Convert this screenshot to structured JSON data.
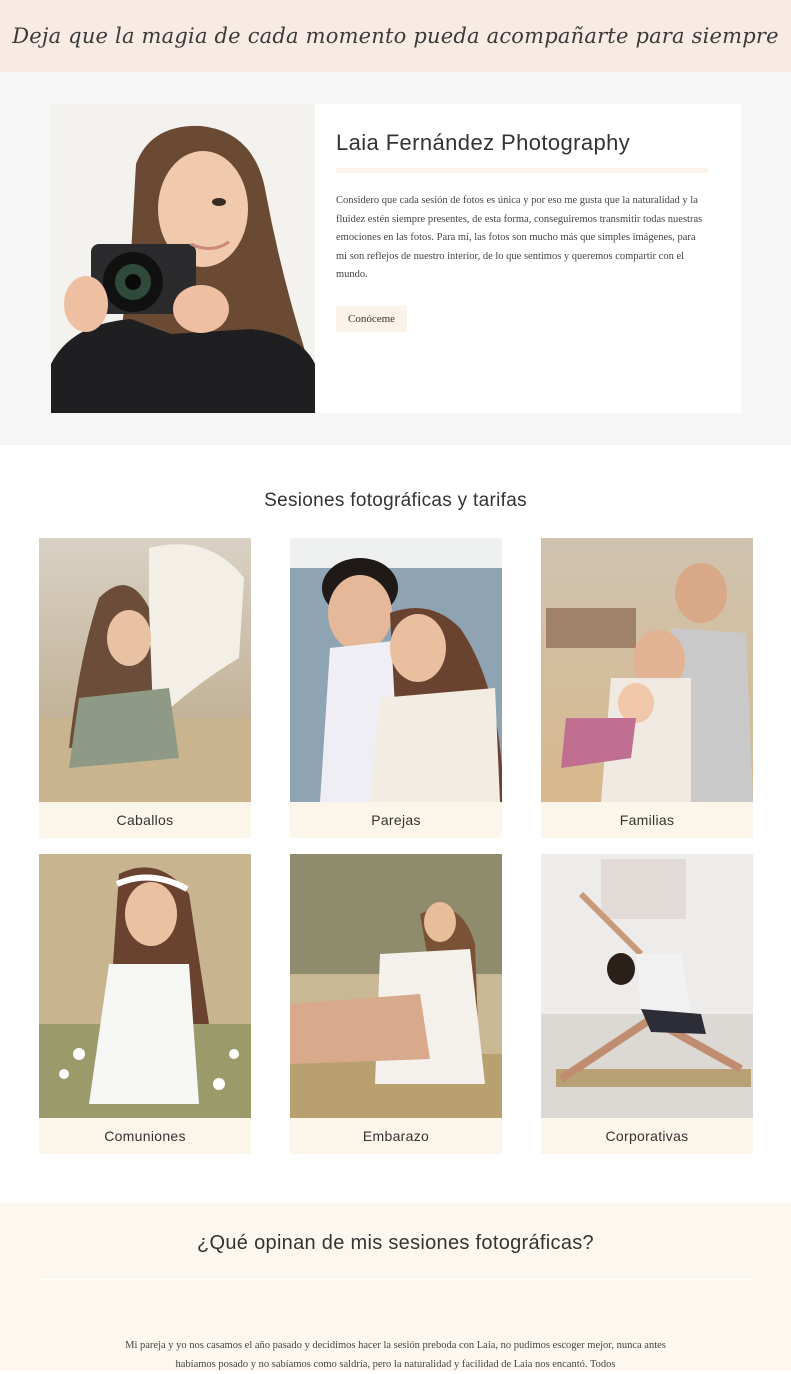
{
  "banner": {
    "tagline": "Deja que la magia de cada momento pueda acompañarte para siempre"
  },
  "about": {
    "title": "Laia Fernández Photography",
    "text": "Considero que cada sesión de fotos es única y por eso me gusta que la naturalidad y la fluidez estén siempre presentes, de esta forma, conseguiremos transmitir todas nuestras emociones en las fotos. Para mí, las fotos son mucho más que simples imágenes, para mi son reflejos de nuestro interior, de lo que sentimos y queremos compartir con el mundo.",
    "button_label": "Conóceme"
  },
  "sessions": {
    "title": "Sesiones fotográficas y tarifas",
    "items": [
      {
        "label": "Caballos"
      },
      {
        "label": "Parejas"
      },
      {
        "label": "Familias"
      },
      {
        "label": "Comuniones"
      },
      {
        "label": "Embarazo"
      },
      {
        "label": "Corporativas"
      }
    ]
  },
  "testimonials": {
    "title": "¿Qué opinan de mis sesiones fotográficas?",
    "text": "Mi pareja y yo nos casamos el año pasado y decidimos hacer la sesión preboda con Laia, no pudimos escoger mejor, nunca antes habíamos posado y no sabíamos como saldría, pero la naturalidad y facilidad de Laia nos encantó. Todos"
  },
  "colors": {
    "banner_bg": "#f8ebe3",
    "about_bg": "#f6f6f6",
    "label_bg": "#fcf6ea",
    "testimonials_bg": "#fcf8f0"
  }
}
